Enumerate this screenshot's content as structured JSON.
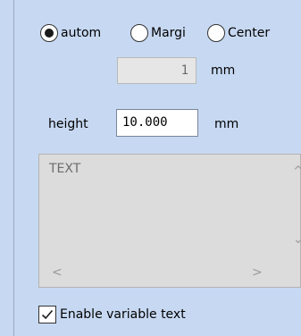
{
  "radios": [
    {
      "label": "autom",
      "checked": true
    },
    {
      "label": "Margi",
      "checked": false
    },
    {
      "label": "Center",
      "checked": false
    }
  ],
  "number_field": {
    "value": "1",
    "unit": "mm"
  },
  "height_field": {
    "label": "height",
    "value": "10.000",
    "unit": "mm"
  },
  "text_area": {
    "value": "TEXT"
  },
  "scroll_arrows": {
    "up": "^",
    "down": "⌄",
    "left": "<",
    "right": ">"
  },
  "checkbox": {
    "label": "Enable variable text",
    "checked": true
  },
  "icons": {
    "radio": "radio-button-icon",
    "check": "checkmark-icon"
  },
  "colors": {
    "panel_background": "#c7d9f2",
    "disabled_field": "#e6e6e6",
    "textarea_background": "#dcdcdc"
  }
}
